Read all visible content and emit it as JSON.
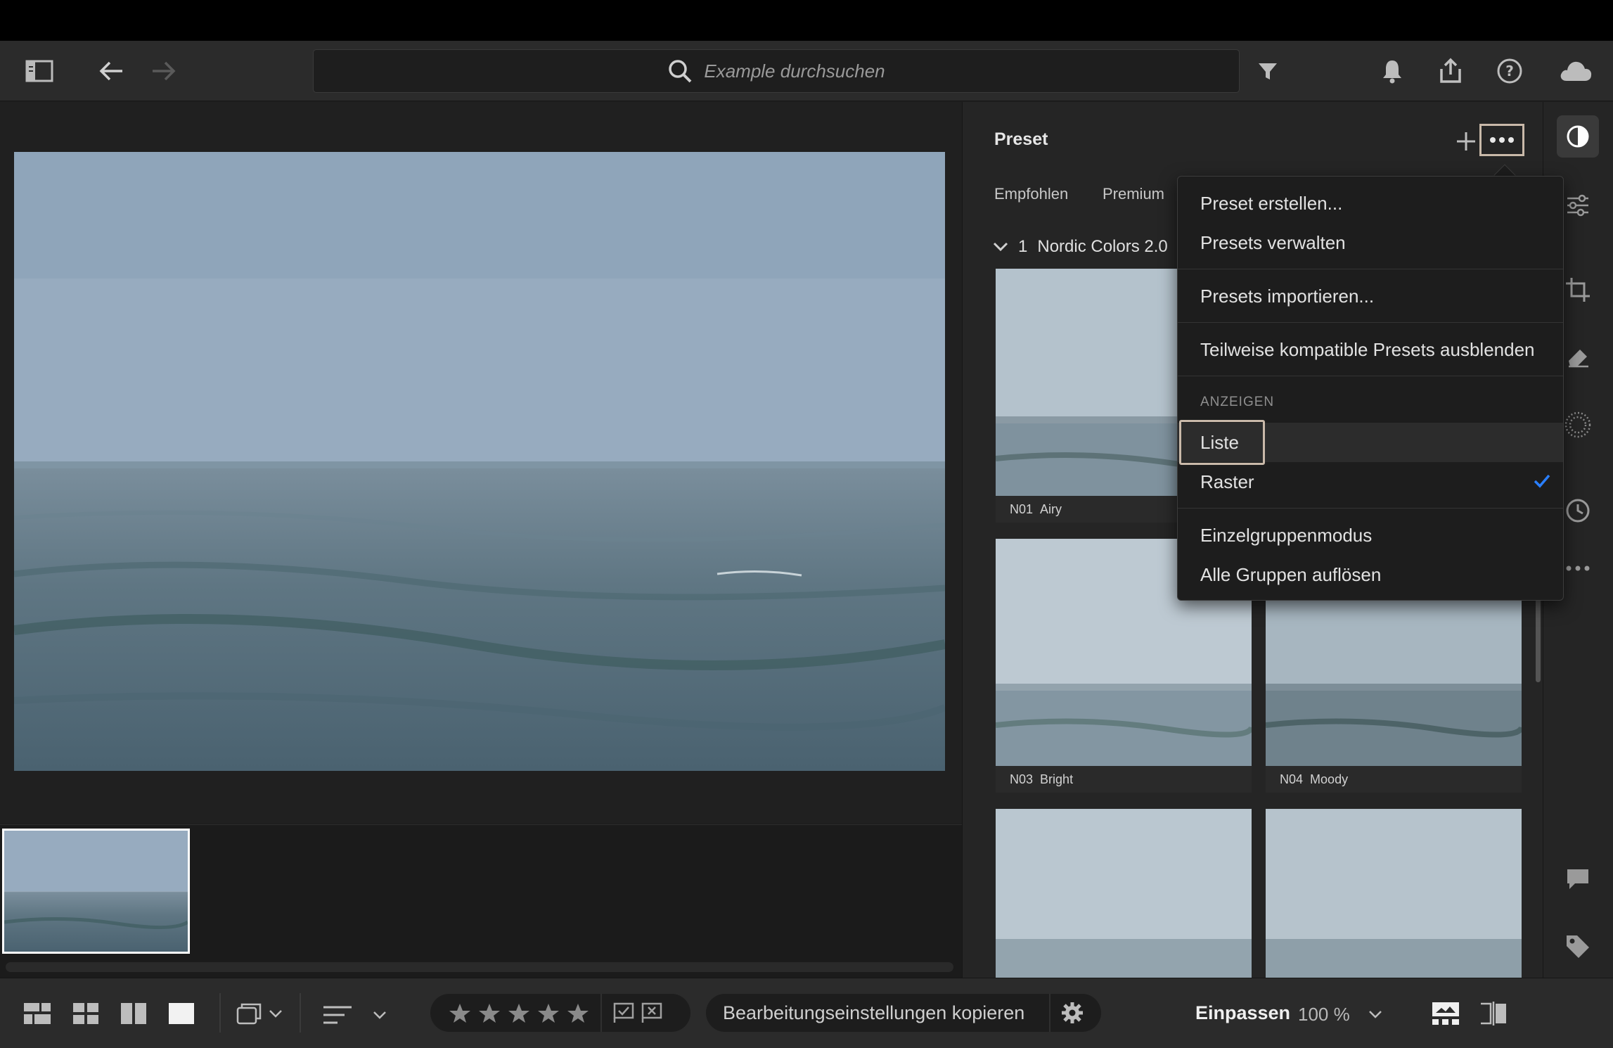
{
  "search": {
    "placeholder": "Example durchsuchen"
  },
  "preset_panel": {
    "title": "Preset",
    "tabs": [
      "Empfohlen",
      "Premium"
    ],
    "group": {
      "count": "1",
      "name": "Nordic Colors 2.0"
    },
    "presets": [
      {
        "code": "N01",
        "name": "Airy"
      },
      {
        "code": "N03",
        "name": "Bright"
      },
      {
        "code": "N04",
        "name": "Moody"
      }
    ]
  },
  "menu": {
    "items": [
      "Preset erstellen...",
      "Presets verwalten",
      "Presets importieren...",
      "Teilweise kompatible Presets ausblenden"
    ],
    "section_header": "ANZEIGEN",
    "view_options": [
      {
        "label": "Liste",
        "checked": false
      },
      {
        "label": "Raster",
        "checked": true
      }
    ],
    "group_items": [
      "Einzelgruppenmodus",
      "Alle Gruppen auflösen"
    ]
  },
  "bottom_bar": {
    "copy_settings": "Bearbeitungseinstellungen kopieren",
    "fit": "Einpassen",
    "zoom": "100 %"
  },
  "colors": {
    "accent_blue": "#2a7fff",
    "highlight_border": "#c9b9a9"
  },
  "icons": [
    "sidebar-toggle-icon",
    "back-arrow-icon",
    "forward-arrow-icon",
    "search-icon",
    "filter-icon",
    "bell-icon",
    "share-icon",
    "help-icon",
    "cloud-icon",
    "presets-icon",
    "edit-sliders-icon",
    "crop-icon",
    "healing-icon",
    "masking-icon",
    "history-icon",
    "more-icon",
    "comment-icon",
    "tag-icon",
    "info-icon",
    "plus-icon",
    "ellipsis-icon",
    "chevron-down-icon",
    "checkmark-icon",
    "star-icon",
    "flag-icon",
    "reject-flag-icon",
    "gear-icon",
    "photo-grid-icon",
    "square-grid-icon",
    "compare-icon",
    "single-view-icon",
    "stack-icon",
    "sort-icon",
    "filmstrip-icon",
    "split-view-icon"
  ]
}
